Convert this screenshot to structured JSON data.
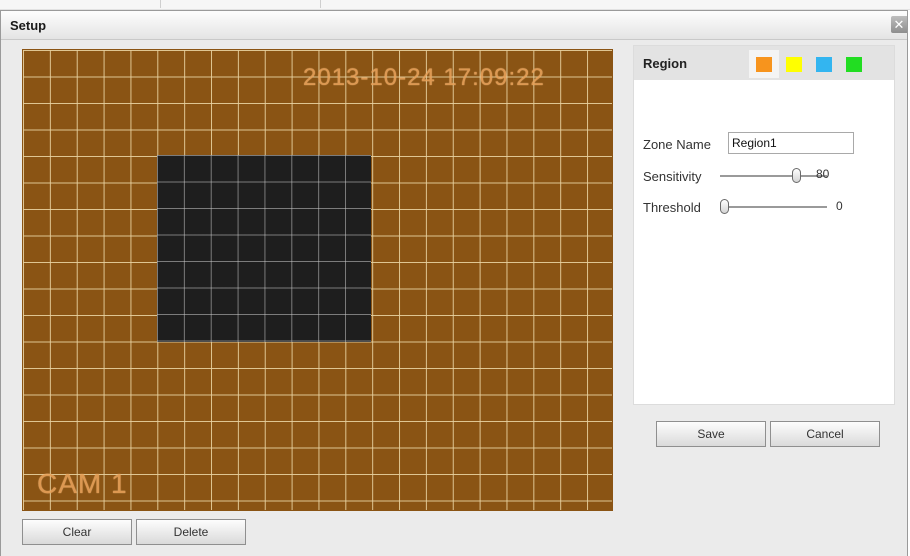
{
  "dialog": {
    "title": "Setup",
    "close_glyph": "✕"
  },
  "video": {
    "timestamp": "2013-10-24 17:09:22",
    "camera_label": "CAM 1",
    "background_color": "#8a5414",
    "masked_color": "#1e1e1e"
  },
  "bottom_buttons": {
    "clear_label": "Clear",
    "delete_label": "Delete"
  },
  "panel": {
    "header": "Region",
    "swatches": [
      {
        "name": "orange",
        "color": "#f7941d",
        "active": true
      },
      {
        "name": "yellow",
        "color": "#ffff00",
        "active": false
      },
      {
        "name": "blue",
        "color": "#33b5f0",
        "active": false
      },
      {
        "name": "green",
        "color": "#22dd22",
        "active": false
      }
    ],
    "zone_name_label": "Zone Name",
    "zone_name_value": "Region1",
    "sensitivity_label": "Sensitivity",
    "sensitivity_value": "80",
    "threshold_label": "Threshold",
    "threshold_value": "0"
  },
  "actions": {
    "save_label": "Save",
    "cancel_label": "Cancel"
  }
}
